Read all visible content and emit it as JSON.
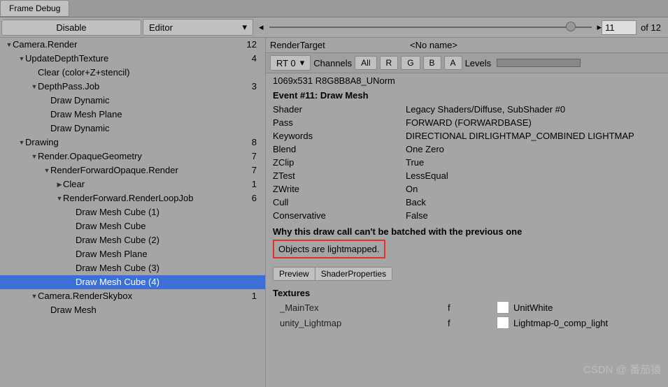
{
  "tab": "Frame Debug",
  "toolbar": {
    "disable": "Disable",
    "editor": "Editor",
    "current": "11",
    "total": "of 12"
  },
  "tree": [
    {
      "d": 0,
      "exp": true,
      "label": "Camera.Render",
      "count": "12"
    },
    {
      "d": 1,
      "exp": true,
      "label": "UpdateDepthTexture",
      "count": "4"
    },
    {
      "d": 2,
      "exp": false,
      "label": "Clear (color+Z+stencil)",
      "count": ""
    },
    {
      "d": 2,
      "exp": true,
      "label": "DepthPass.Job",
      "count": "3"
    },
    {
      "d": 3,
      "exp": false,
      "label": "Draw Dynamic",
      "count": ""
    },
    {
      "d": 3,
      "exp": false,
      "label": "Draw Mesh Plane",
      "count": ""
    },
    {
      "d": 3,
      "exp": false,
      "label": "Draw Dynamic",
      "count": ""
    },
    {
      "d": 1,
      "exp": true,
      "label": "Drawing",
      "count": "8"
    },
    {
      "d": 2,
      "exp": true,
      "label": "Render.OpaqueGeometry",
      "count": "7"
    },
    {
      "d": 3,
      "exp": true,
      "label": "RenderForwardOpaque.Render",
      "count": "7"
    },
    {
      "d": 4,
      "exp": false,
      "arrow": true,
      "label": "Clear",
      "count": "1"
    },
    {
      "d": 4,
      "exp": true,
      "label": "RenderForward.RenderLoopJob",
      "count": "6"
    },
    {
      "d": 5,
      "exp": false,
      "label": "Draw Mesh Cube (1)",
      "count": ""
    },
    {
      "d": 5,
      "exp": false,
      "label": "Draw Mesh Cube",
      "count": ""
    },
    {
      "d": 5,
      "exp": false,
      "label": "Draw Mesh Cube (2)",
      "count": ""
    },
    {
      "d": 5,
      "exp": false,
      "label": "Draw Mesh Plane",
      "count": ""
    },
    {
      "d": 5,
      "exp": false,
      "label": "Draw Mesh Cube (3)",
      "count": ""
    },
    {
      "d": 5,
      "exp": false,
      "label": "Draw Mesh Cube (4)",
      "count": "",
      "sel": true
    },
    {
      "d": 2,
      "exp": true,
      "label": "Camera.RenderSkybox",
      "count": "1"
    },
    {
      "d": 3,
      "exp": false,
      "label": "Draw Mesh",
      "count": ""
    }
  ],
  "rt": {
    "label": "RenderTarget",
    "value": "<No name>",
    "rt0": "RT 0",
    "channels": "Channels",
    "all": "All",
    "r": "R",
    "g": "G",
    "b": "B",
    "a": "A",
    "levels": "Levels"
  },
  "res": "1069x531 R8G8B8A8_UNorm",
  "event": "Event #11: Draw Mesh",
  "props": [
    {
      "k": "Shader",
      "v": "Legacy Shaders/Diffuse, SubShader #0"
    },
    {
      "k": "Pass",
      "v": "FORWARD (FORWARDBASE)"
    },
    {
      "k": "Keywords",
      "v": "DIRECTIONAL DIRLIGHTMAP_COMBINED LIGHTMAP"
    },
    {
      "k": "Blend",
      "v": "One Zero"
    },
    {
      "k": "ZClip",
      "v": "True"
    },
    {
      "k": "ZTest",
      "v": "LessEqual"
    },
    {
      "k": "ZWrite",
      "v": "On"
    },
    {
      "k": "Cull",
      "v": "Back"
    },
    {
      "k": "Conservative",
      "v": "False"
    }
  ],
  "batch": {
    "header": "Why this draw call can't be batched with the previous one",
    "reason": "Objects are lightmapped."
  },
  "buttons": {
    "preview": "Preview",
    "shaderprops": "ShaderProperties"
  },
  "textures": {
    "header": "Textures",
    "rows": [
      {
        "name": "_MainTex",
        "f": "f",
        "val": "UnitWhite"
      },
      {
        "name": "unity_Lightmap",
        "f": "f",
        "val": "Lightmap-0_comp_light"
      }
    ]
  },
  "watermark": "CSDN @ 番茄猿"
}
